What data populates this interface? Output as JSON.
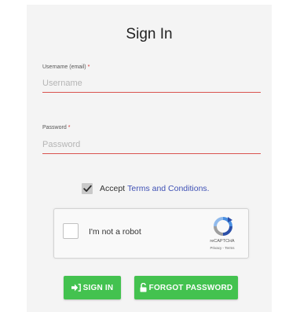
{
  "form": {
    "title": "Sign In",
    "username": {
      "label": "Username (email)",
      "required_mark": "*",
      "placeholder": "Username"
    },
    "password": {
      "label": "Password",
      "required_mark": "*",
      "placeholder": "Password"
    },
    "accept": {
      "prefix": "Accept",
      "link": "Terms and Conditions.",
      "checked": true
    }
  },
  "captcha": {
    "label": "I'm not a robot",
    "brand": "reCAPTCHA",
    "links": "Privacy - Terms"
  },
  "buttons": {
    "sign_in": "SIGN IN",
    "forgot_password": "FORGOT PASSWORD"
  },
  "colors": {
    "button_green": "#43c24f",
    "input_underline": "#d9534f",
    "link": "#3f51b5",
    "required": "#d32f2f"
  }
}
